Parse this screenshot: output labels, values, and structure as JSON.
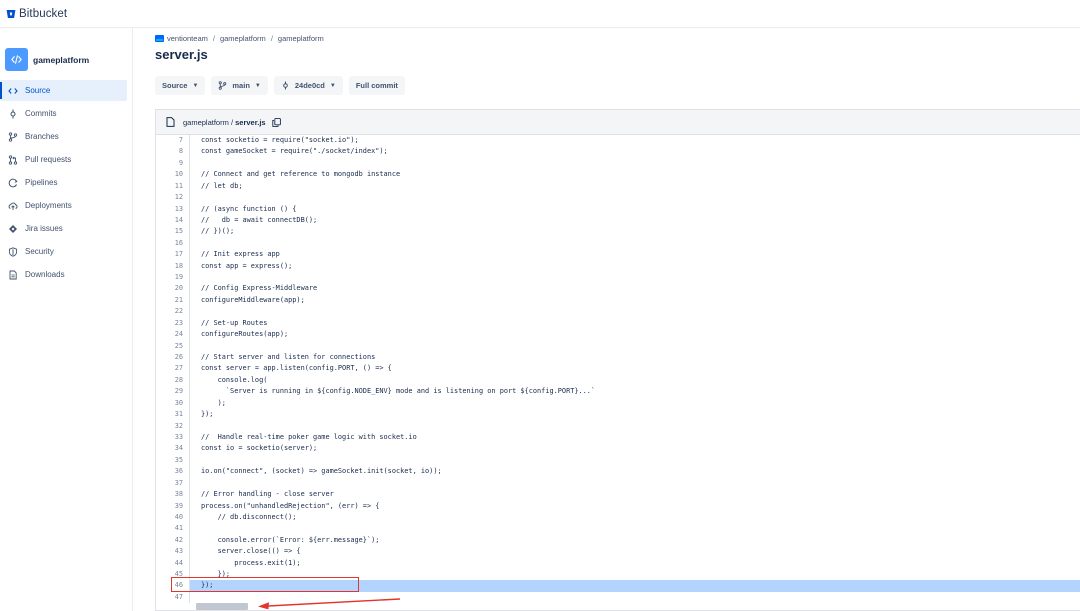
{
  "app": {
    "brand": "Bitbucket"
  },
  "repo": {
    "name": "gameplatform"
  },
  "sidebar": {
    "items": [
      {
        "label": "Source",
        "icon": "code-icon",
        "active": true
      },
      {
        "label": "Commits",
        "icon": "commit-icon",
        "active": false
      },
      {
        "label": "Branches",
        "icon": "branch-icon",
        "active": false
      },
      {
        "label": "Pull requests",
        "icon": "pull-request-icon",
        "active": false
      },
      {
        "label": "Pipelines",
        "icon": "pipelines-icon",
        "active": false
      },
      {
        "label": "Deployments",
        "icon": "cloud-upload-icon",
        "active": false
      },
      {
        "label": "Jira issues",
        "icon": "jira-icon",
        "active": false
      },
      {
        "label": "Security",
        "icon": "shield-icon",
        "active": false
      },
      {
        "label": "Downloads",
        "icon": "file-icon",
        "active": false
      }
    ]
  },
  "breadcrumb": {
    "workspace": "ventionteam",
    "project": "gameplatform",
    "repo": "gameplatform"
  },
  "page": {
    "title": "server.js"
  },
  "toolbar": {
    "source_label": "Source",
    "branch_label": "main",
    "commit_label": "24de0cd",
    "full_commit_label": "Full commit"
  },
  "file": {
    "path_dir": "gameplatform",
    "path_sep": " / ",
    "path_file": "server.js"
  },
  "code_lines": [
    {
      "n": "7",
      "t": "const socketio = require(\"socket.io\");"
    },
    {
      "n": "8",
      "t": "const gameSocket = require(\"./socket/index\");"
    },
    {
      "n": "9",
      "t": ""
    },
    {
      "n": "10",
      "t": "// Connect and get reference to mongodb instance"
    },
    {
      "n": "11",
      "t": "// let db;"
    },
    {
      "n": "12",
      "t": ""
    },
    {
      "n": "13",
      "t": "// (async function () {"
    },
    {
      "n": "14",
      "t": "//   db = await connectDB();"
    },
    {
      "n": "15",
      "t": "// })();"
    },
    {
      "n": "16",
      "t": ""
    },
    {
      "n": "17",
      "t": "// Init express app"
    },
    {
      "n": "18",
      "t": "const app = express();"
    },
    {
      "n": "19",
      "t": ""
    },
    {
      "n": "20",
      "t": "// Config Express-Middleware"
    },
    {
      "n": "21",
      "t": "configureMiddleware(app);"
    },
    {
      "n": "22",
      "t": ""
    },
    {
      "n": "23",
      "t": "// Set-up Routes"
    },
    {
      "n": "24",
      "t": "configureRoutes(app);"
    },
    {
      "n": "25",
      "t": ""
    },
    {
      "n": "26",
      "t": "// Start server and listen for connections"
    },
    {
      "n": "27",
      "t": "const server = app.listen(config.PORT, () => {"
    },
    {
      "n": "28",
      "t": "    console.log("
    },
    {
      "n": "29",
      "t": "      `Server is running in ${config.NODE_ENV} mode and is listening on port ${config.PORT}...`"
    },
    {
      "n": "30",
      "t": "    );"
    },
    {
      "n": "31",
      "t": "});"
    },
    {
      "n": "32",
      "t": ""
    },
    {
      "n": "33",
      "t": "//  Handle real-time poker game logic with socket.io"
    },
    {
      "n": "34",
      "t": "const io = socketio(server);"
    },
    {
      "n": "35",
      "t": ""
    },
    {
      "n": "36",
      "t": "io.on(\"connect\", (socket) => gameSocket.init(socket, io));"
    },
    {
      "n": "37",
      "t": ""
    },
    {
      "n": "38",
      "t": "// Error handling - close server"
    },
    {
      "n": "39",
      "t": "process.on(\"unhandledRejection\", (err) => {"
    },
    {
      "n": "40",
      "t": "    // db.disconnect();"
    },
    {
      "n": "41",
      "t": ""
    },
    {
      "n": "42",
      "t": "    console.error(`Error: ${err.message}`);"
    },
    {
      "n": "43",
      "t": "    server.close(() => {"
    },
    {
      "n": "44",
      "t": "        process.exit(1);"
    },
    {
      "n": "45",
      "t": "    });"
    },
    {
      "n": "46",
      "t": "});",
      "highlight": true
    },
    {
      "n": "47",
      "t": ""
    }
  ],
  "colors": {
    "accent": "#0052cc",
    "selection": "#b3d4ff",
    "annotation": "#e0362c"
  }
}
